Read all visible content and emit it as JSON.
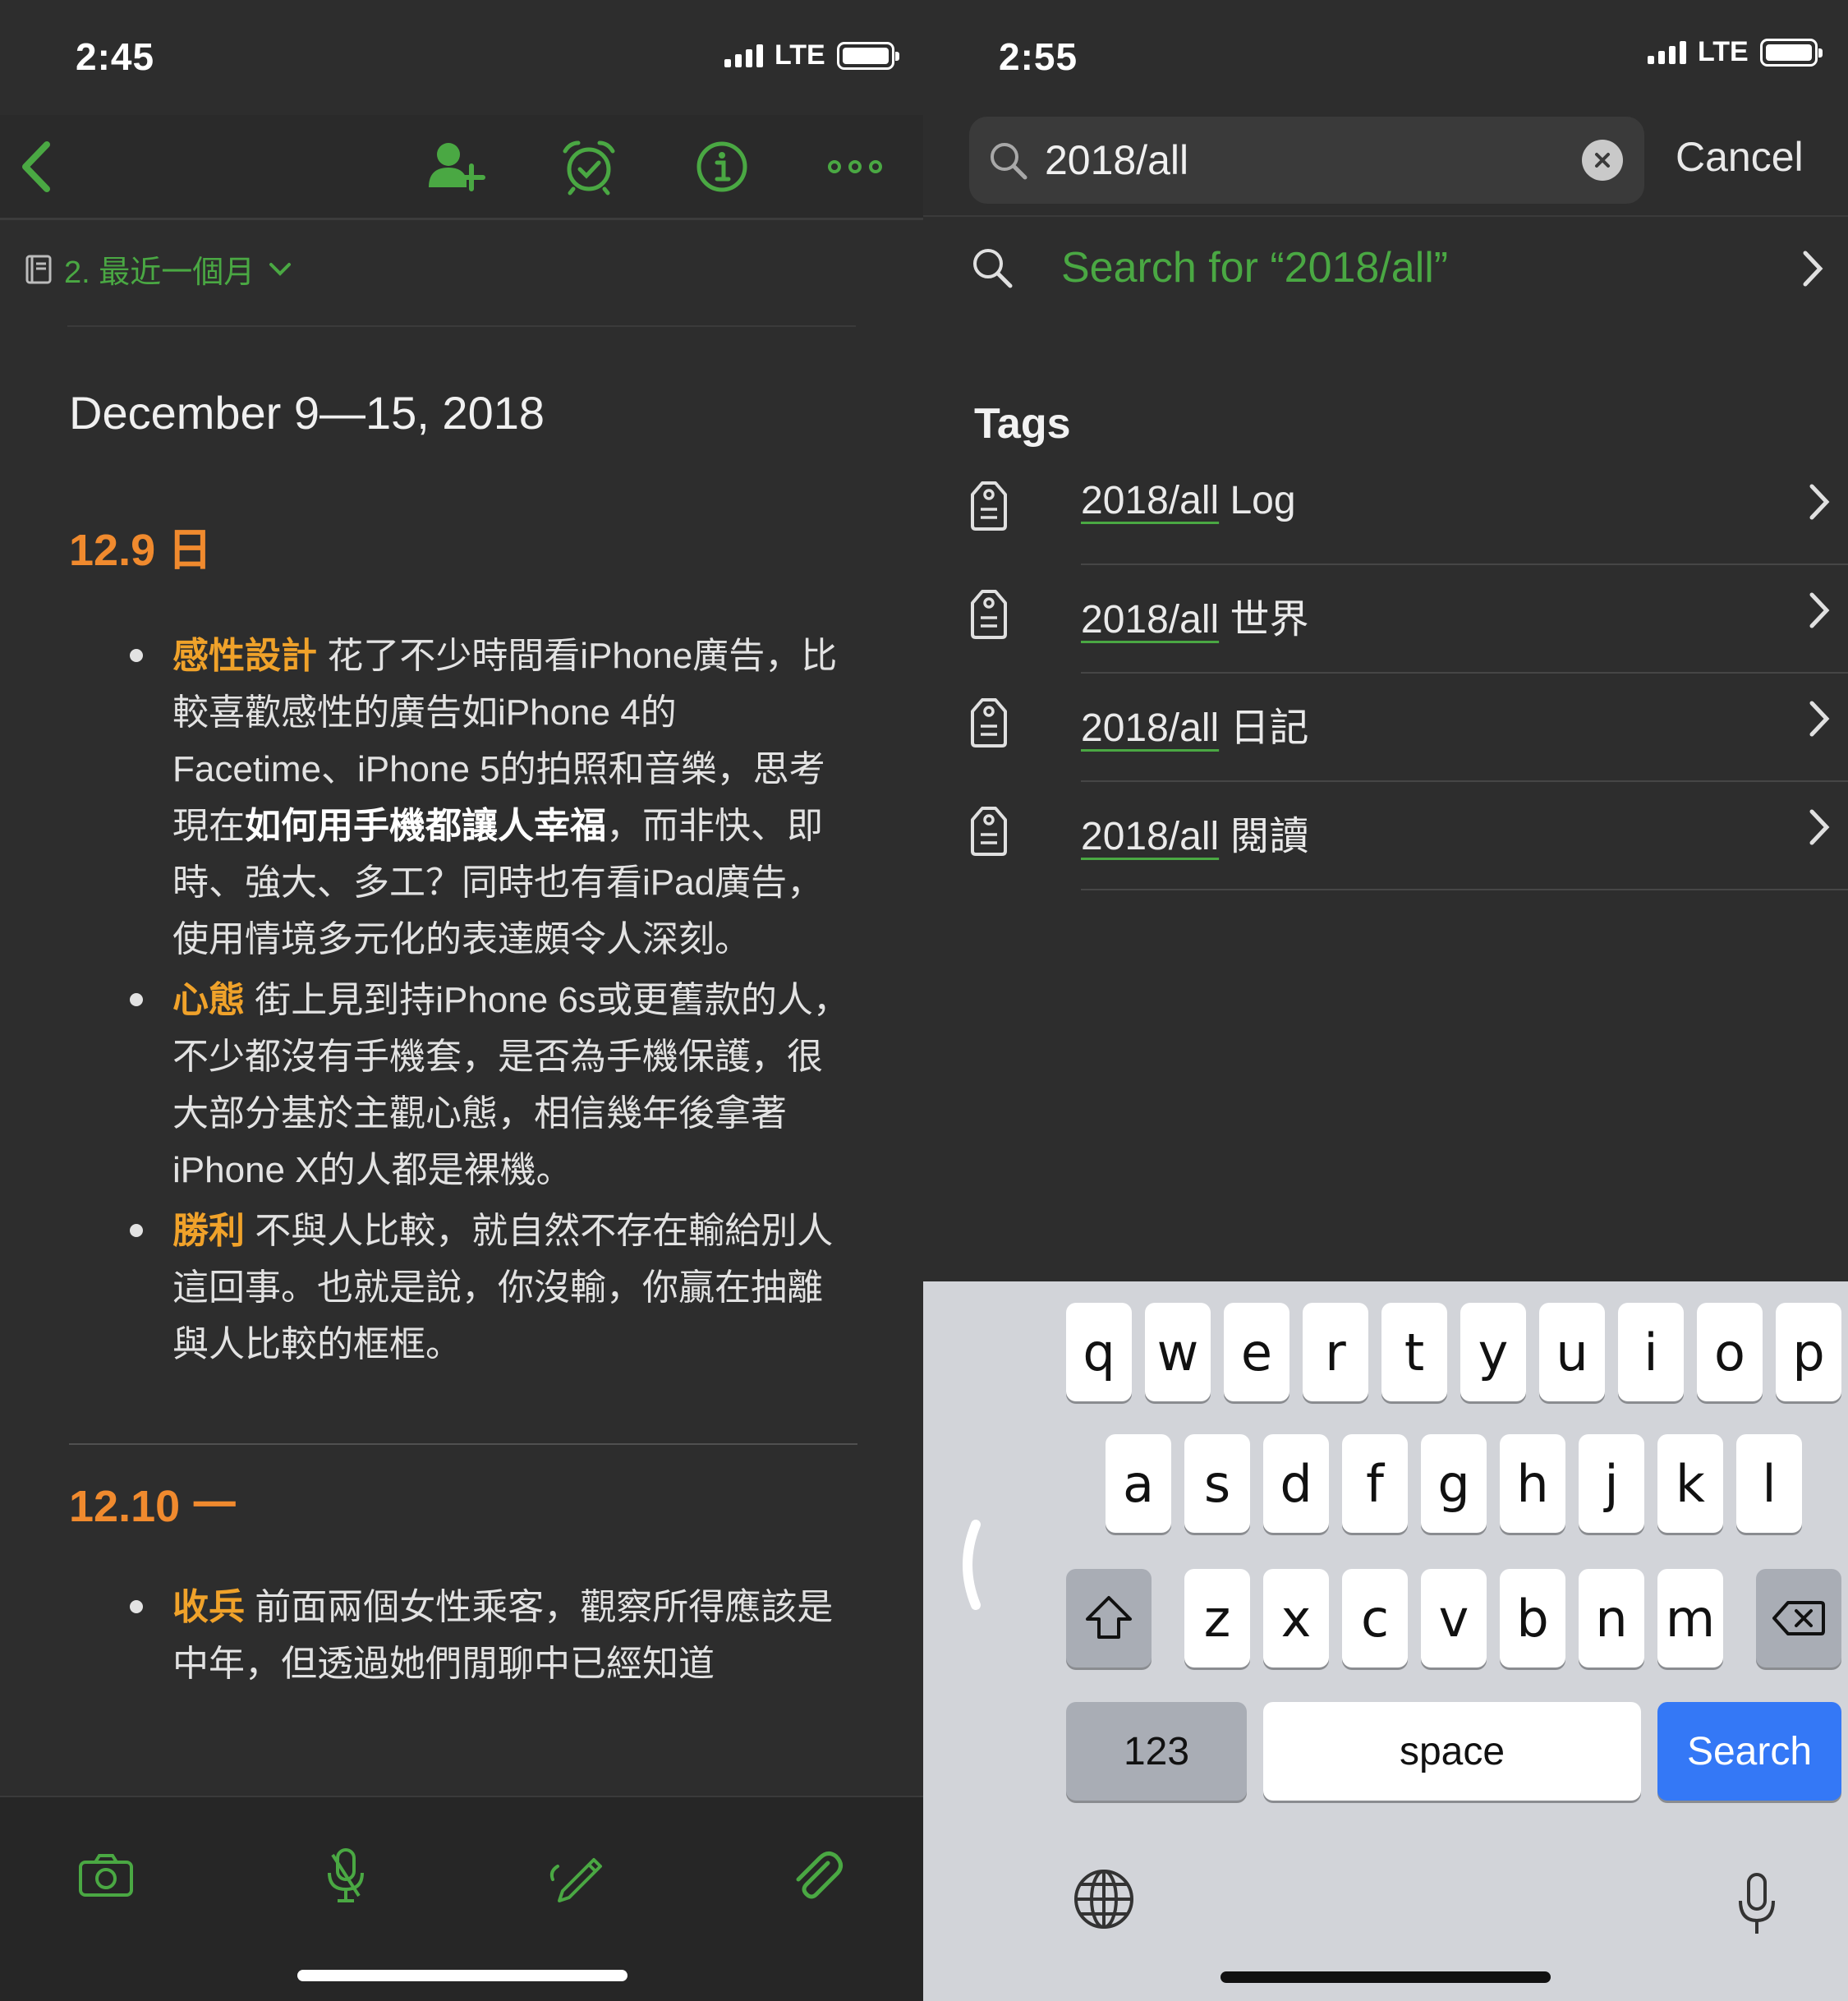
{
  "left": {
    "status": {
      "time": "2:45",
      "network": "LTE"
    },
    "notebook": {
      "name": "2. 最近一個月"
    },
    "note": {
      "title": "December 9—15, 2018",
      "sections": [
        {
          "heading": "12.9 日",
          "bullets": [
            {
              "keyword": "感性設計",
              "parts": [
                " 花了不少時間看iPhone廣告，比較喜歡感性的廣告如iPhone 4的Facetime、iPhone 5的拍照和音樂，思考現在",
                "如何用手機都讓人幸福",
                "，而非快、即時、強大、多工？同時也有看iPad廣告，使用情境多元化的表達頗令人深刻。"
              ]
            },
            {
              "keyword": "心態",
              "parts": [
                " 街上見到持iPhone 6s或更舊款的人，不少都沒有手機套，是否為手機保護，很大部分基於主觀心態，相信幾年後拿著iPhone X的人都是裸機。"
              ]
            },
            {
              "keyword": "勝利",
              "parts": [
                " 不與人比較，就自然不存在輸給別人這回事。也就是說，你沒輸，你贏在抽離與人比較的框框。"
              ]
            }
          ]
        },
        {
          "heading": "12.10 一",
          "bullets": [
            {
              "keyword": "收兵",
              "parts": [
                " 前面兩個女性乘客，觀察所得應該是中年，但透過她們閒聊中已經知道"
              ]
            }
          ]
        }
      ]
    },
    "colors": {
      "accent": "#4aa843",
      "heading": "#f08a2e",
      "keyword": "#f0a22a"
    }
  },
  "right": {
    "status": {
      "time": "2:55",
      "network": "LTE"
    },
    "search": {
      "query": "2018/all",
      "cancel_label": "Cancel",
      "search_for_label": "Search for “2018/all”"
    },
    "tags": {
      "heading": "Tags",
      "items": [
        {
          "match": "2018/all",
          "rest": " Log"
        },
        {
          "match": "2018/all",
          "rest": " 世界"
        },
        {
          "match": "2018/all",
          "rest": " 日記"
        },
        {
          "match": "2018/all",
          "rest": " 閱讀"
        }
      ]
    },
    "keyboard": {
      "row1": [
        "q",
        "w",
        "e",
        "r",
        "t",
        "y",
        "u",
        "i",
        "o",
        "p"
      ],
      "row2": [
        "a",
        "s",
        "d",
        "f",
        "g",
        "h",
        "j",
        "k",
        "l"
      ],
      "row3": [
        "z",
        "x",
        "c",
        "v",
        "b",
        "n",
        "m"
      ],
      "numbers_label": "123",
      "space_label": "space",
      "action_label": "Search"
    },
    "colors": {
      "accent": "#4aa843",
      "search_key": "#3478f6"
    }
  }
}
